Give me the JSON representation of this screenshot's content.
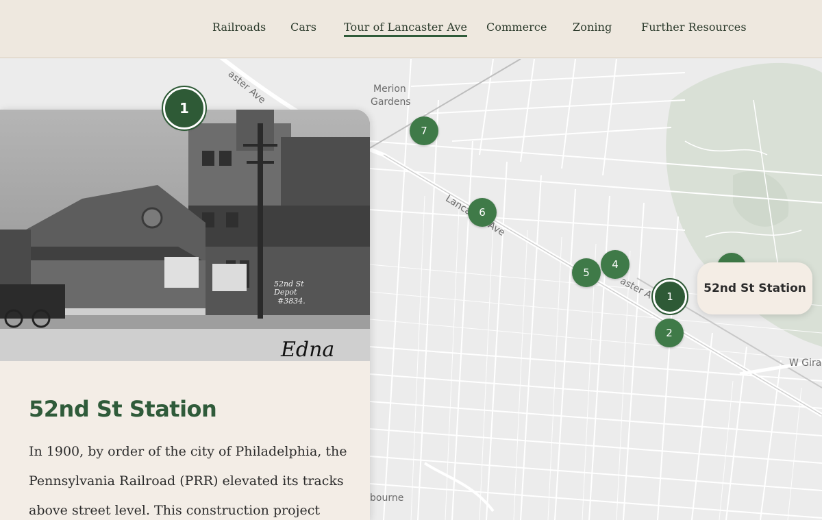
{
  "nav": {
    "items": [
      {
        "label": "Railroads"
      },
      {
        "label": "Cars"
      },
      {
        "label": "Tour of Lancaster Ave",
        "active": true
      },
      {
        "label": "Commerce"
      },
      {
        "label": "Zoning"
      },
      {
        "label": "Further Resources"
      }
    ]
  },
  "map": {
    "labels": {
      "merion_line1": "Merion",
      "merion_line2": "Gardens",
      "lancaster_top": "aster Ave",
      "lancaster_mid": "Lancaster Ave",
      "lancaster_lower": "aster A",
      "girard": "W Gira",
      "overbrook": "bourne"
    },
    "markers": [
      "1",
      "7",
      "6",
      "5",
      "4",
      "1",
      "2"
    ],
    "tooltip": "52nd St Station",
    "photo_caption": "52nd St Depot #3834.",
    "photo_signature": "Edna"
  },
  "card": {
    "title": "52nd St Station",
    "body": "In 1900, by order of the city of Philadelphia, the Pennsylvania Railroad (PRR) elevated its tracks above street level. This construction project"
  },
  "colors": {
    "accent": "#2f5b3a",
    "marker": "#3f7a48",
    "header_bg": "#eee8df",
    "card_bg": "#f3ede6",
    "park": "#d8e0d6"
  }
}
